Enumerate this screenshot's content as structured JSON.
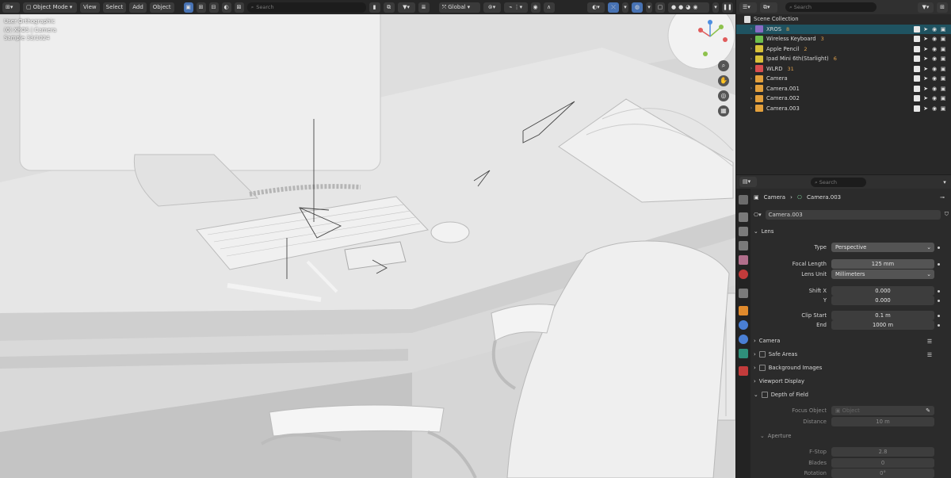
{
  "viewport": {
    "mode": "Object Mode",
    "menus": [
      "View",
      "Select",
      "Add",
      "Object"
    ],
    "search_placeholder": "Search",
    "transform_orientation": "Global",
    "overlay": {
      "line1": "User Orthographic",
      "line2": "(0) XROS | Camera",
      "line3": "Sample 33/1024"
    }
  },
  "outliner": {
    "search_placeholder": "Search",
    "root": "Scene Collection",
    "items": [
      {
        "label": "XROS",
        "badge": "8",
        "icon_color": "#8a6bc4",
        "selected": true
      },
      {
        "label": "Wireless Keyboard",
        "badge": "3",
        "icon_color": "#6fbf4c",
        "selected": false
      },
      {
        "label": "Apple Pencil",
        "badge": "2",
        "icon_color": "#d8c23a",
        "selected": false
      },
      {
        "label": "Ipad Mini 6th(Starlight)",
        "badge": "6",
        "icon_color": "#d8c23a",
        "selected": false
      },
      {
        "label": "WLRD",
        "badge": "31",
        "icon_color": "#d94f4f",
        "selected": false
      },
      {
        "label": "Camera",
        "badge": "",
        "icon_color": "#e3a03c",
        "selected": false
      },
      {
        "label": "Camera.001",
        "badge": "",
        "icon_color": "#e3a03c",
        "selected": false
      },
      {
        "label": "Camera.002",
        "badge": "",
        "icon_color": "#e3a03c",
        "selected": false
      },
      {
        "label": "Camera.003",
        "badge": "",
        "icon_color": "#e3a03c",
        "selected": false
      }
    ]
  },
  "properties": {
    "search_placeholder": "Search",
    "breadcrumb_object": "Camera",
    "breadcrumb_data": "Camera.003",
    "data_name": "Camera.003",
    "lens_section": "Lens",
    "type_label": "Type",
    "type_value": "Perspective",
    "focal_label": "Focal Length",
    "focal_value": "125 mm",
    "lens_unit_label": "Lens Unit",
    "lens_unit_value": "Millimeters",
    "shift_x_label": "Shift X",
    "shift_x_value": "0.000",
    "shift_y_label": "Y",
    "shift_y_value": "0.000",
    "clip_start_label": "Clip Start",
    "clip_start_value": "0.1 m",
    "clip_end_label": "End",
    "clip_end_value": "1000 m",
    "sections": [
      "Camera",
      "Safe Areas",
      "Background Images",
      "Viewport Display",
      "Depth of Field"
    ],
    "focus_object_label": "Focus Object",
    "focus_object_placeholder": "Object",
    "distance_label": "Distance",
    "distance_value": "10 m",
    "aperture_section": "Aperture",
    "fstop_label": "F-Stop",
    "fstop_value": "2.8",
    "blades_label": "Blades",
    "blades_value": "0",
    "rotation_label": "Rotation",
    "rotation_value": "0°"
  },
  "colors": {
    "accent": "#4772b3",
    "selection": "#1f5361",
    "panel": "#2b2b2b"
  }
}
